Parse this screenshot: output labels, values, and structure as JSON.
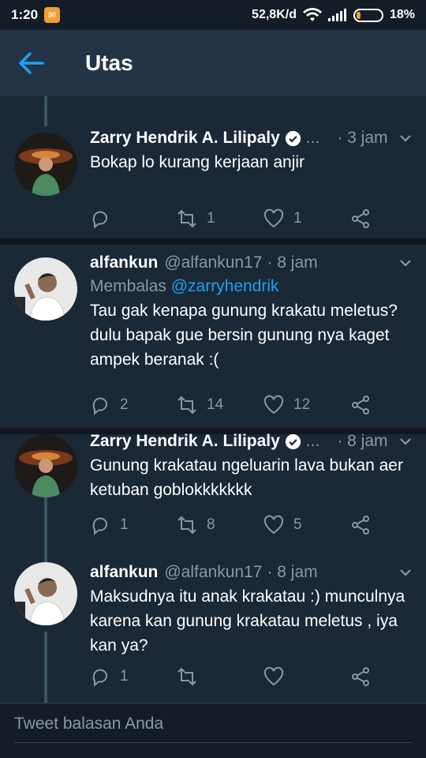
{
  "status_bar": {
    "time": "1:20",
    "network_speed": "52,8K/d",
    "battery": "18%",
    "battery_level": 0.18
  },
  "app_bar": {
    "title": "Utas"
  },
  "colors": {
    "accent": "#1da1f2",
    "background": "#1b2836",
    "appbar": "#243447",
    "muted": "#8899a6"
  },
  "tweets": [
    {
      "name": "Zarry Hendrik A. Lilipaly",
      "verified": true,
      "handle": "",
      "ellipsis": "...",
      "time": "3 jam",
      "reply_to_prefix": "",
      "reply_to_mention": "",
      "text": "Bokap lo kurang kerjaan anjir",
      "replies": "",
      "retweets": "1",
      "likes": "1"
    },
    {
      "name": "alfankun",
      "verified": false,
      "handle": "@alfankun17",
      "ellipsis": "",
      "time": "8 jam",
      "reply_to_prefix": "Membalas ",
      "reply_to_mention": "@zarryhendrik",
      "text": "Tau gak kenapa gunung krakatu meletus? dulu bapak gue bersin gunung nya kaget ampek beranak :(",
      "replies": "2",
      "retweets": "14",
      "likes": "12"
    },
    {
      "name": "Zarry Hendrik A. Lilipaly",
      "verified": true,
      "handle": "",
      "ellipsis": "...",
      "time": "8 jam",
      "reply_to_prefix": "",
      "reply_to_mention": "",
      "text": "Gunung krakatau ngeluarin lava bukan aer ketuban goblokkkkkkk",
      "replies": "1",
      "retweets": "8",
      "likes": "5"
    },
    {
      "name": "alfankun",
      "verified": false,
      "handle": "@alfankun17",
      "ellipsis": "",
      "time": "8 jam",
      "reply_to_prefix": "",
      "reply_to_mention": "",
      "text": "Maksudnya itu anak krakatau :) munculnya karena kan gunung krakatau meletus , iya kan ya?",
      "replies": "1",
      "retweets": "",
      "likes": ""
    }
  ],
  "composer": {
    "placeholder": "Tweet balasan Anda"
  }
}
